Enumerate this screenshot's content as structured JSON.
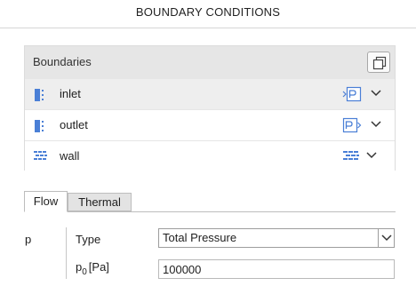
{
  "panel": {
    "title": "BOUNDARY CONDITIONS"
  },
  "boundaries": {
    "header_label": "Boundaries",
    "copy_icon": "copy-icon",
    "items": [
      {
        "label": "inlet",
        "left_icon": "inlet-boundary-icon",
        "right_icon": "pressure-inlet-icon",
        "selected": true
      },
      {
        "label": "outlet",
        "left_icon": "outlet-boundary-icon",
        "right_icon": "pressure-outlet-icon",
        "selected": false
      },
      {
        "label": "wall",
        "left_icon": "wall-boundary-icon",
        "right_icon": "wall-icon",
        "selected": false
      }
    ]
  },
  "tabs": [
    {
      "label": "Flow",
      "active": true
    },
    {
      "label": "Thermal",
      "active": false
    }
  ],
  "form": {
    "variable": "p",
    "type_label": "Type",
    "type_value": "Total Pressure",
    "p0_label_main": "p",
    "p0_label_sub": "0",
    "p0_label_unit": "[Pa]",
    "p0_value": "100000"
  },
  "colors": {
    "accent_blue": "#4a7fd6",
    "header_bg": "#e6e6e6",
    "selected_row_bg": "#eeeeee"
  }
}
